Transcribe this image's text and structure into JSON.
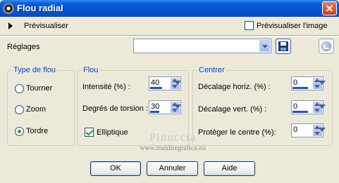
{
  "window": {
    "title": "Flou radial",
    "close_glyph": "✕"
  },
  "preview": {
    "label": "Prévisualiser",
    "checkbox_label": "Prévisualiser l'image",
    "checked": false
  },
  "settings": {
    "label": "Réglages",
    "value": ""
  },
  "type_group": {
    "title": "Type de flou",
    "options": [
      {
        "label": "Tourner",
        "selected": false
      },
      {
        "label": "Zoom",
        "selected": false
      },
      {
        "label": "Tordre",
        "selected": true
      }
    ]
  },
  "flou_group": {
    "title": "Flou",
    "intensite_label": "Intensité (%) :",
    "intensite_value": "40",
    "intensite_level_percent": 40,
    "torsion_label": "Degrés de torsion :",
    "torsion_value": "30",
    "torsion_level_percent": 30,
    "elliptique_label": "Elliptique",
    "elliptique_checked": true
  },
  "centre_group": {
    "title": "Centrer",
    "horiz_label": "Décalage horiz. (%) :",
    "horiz_value": "0",
    "vert_label": "Décalage vert. (%) :",
    "vert_value": "0",
    "protect_label": "Protéger le centre (%):",
    "protect_value": "0"
  },
  "watermark": {
    "name": "Pinuccia",
    "url": "www.maidiregrafica.eu"
  },
  "buttons": {
    "ok": "OK",
    "annuler": "Annuler",
    "aide": "Aide"
  },
  "colors": {
    "titlebar": "#0454d0",
    "group_title": "#0046d5",
    "dialog_bg": "#ece9d8"
  }
}
